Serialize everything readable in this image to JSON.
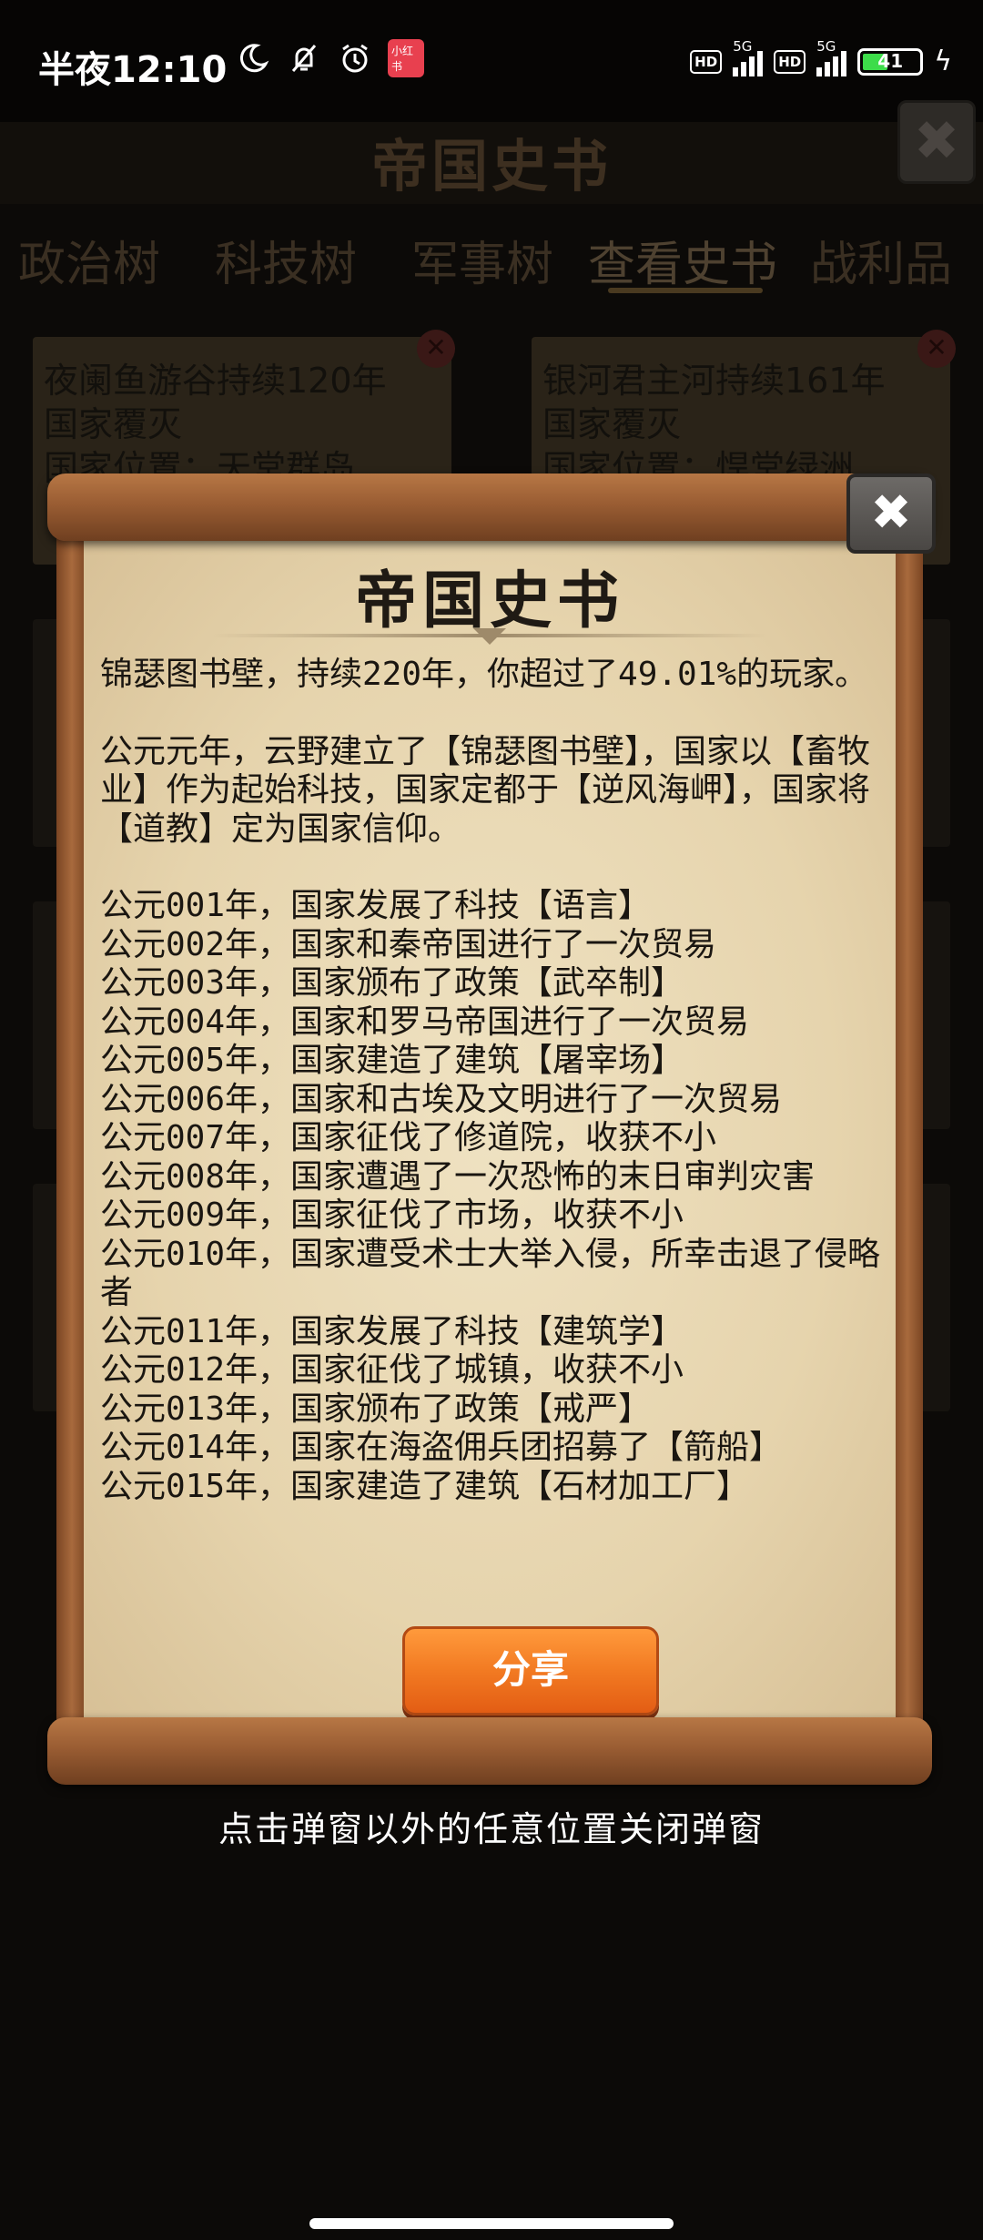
{
  "status_bar": {
    "time": "半夜12:10",
    "icons": [
      "moon-icon",
      "bell-off-icon",
      "alarm-icon"
    ],
    "badge": "小红书",
    "hd1": "HD",
    "net1": "5G",
    "hd2": "HD",
    "net2": "5G",
    "battery": "41"
  },
  "background": {
    "title": "帝国史书",
    "close_label": "✖",
    "tabs": [
      "政治树",
      "科技树",
      "军事树",
      "查看史书",
      "战利品"
    ],
    "active_tab_index": 3,
    "cards": [
      {
        "line1": "夜阑鱼游谷持续120年",
        "line2": "国家覆灭",
        "line3": "国家位置：天堂群岛"
      },
      {
        "line1": "银河君主河持续161年",
        "line2": "国家覆灭",
        "line3": "国家位置：悍堂绿洲"
      }
    ]
  },
  "dialog": {
    "title": "帝国史书",
    "close_label": "✖",
    "summary": "锦瑟图书壁，持续220年，你超过了49.01%的玩家。",
    "origin": "公元元年，云野建立了【锦瑟图书壁】，国家以【畜牧业】作为起始科技，国家定都于【逆风海岬】，国家将【道教】定为国家信仰。",
    "events": [
      "公元001年，国家发展了科技【语言】",
      "公元002年，国家和秦帝国进行了一次贸易",
      "公元003年，国家颁布了政策【武卒制】",
      "公元004年，国家和罗马帝国进行了一次贸易",
      "公元005年，国家建造了建筑【屠宰场】",
      "公元006年，国家和古埃及文明进行了一次贸易",
      "公元007年，国家征伐了修道院，收获不小",
      "公元008年，国家遭遇了一次恐怖的末日审判灾害",
      "公元009年，国家征伐了市场，收获不小",
      "公元010年，国家遭受术士大举入侵，所幸击退了侵略者",
      "公元011年，国家发展了科技【建筑学】",
      "公元012年，国家征伐了城镇，收获不小",
      "公元013年，国家颁布了政策【戒严】",
      "公元014年，国家在海盗佣兵团招募了【箭船】",
      "公元015年，国家建造了建筑【石材加工厂】"
    ],
    "share_label": "分享"
  },
  "hint": "点击弹窗以外的任意位置关闭弹窗"
}
